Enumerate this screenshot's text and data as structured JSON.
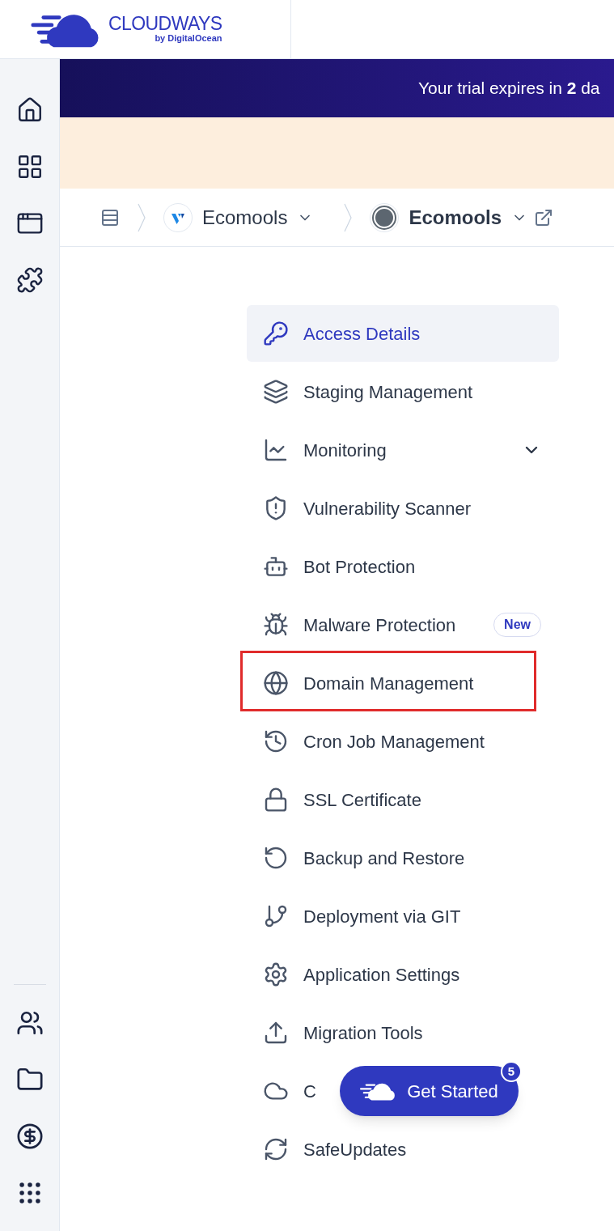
{
  "logo": {
    "name": "CLOUDWAYS",
    "byline": "by DigitalOcean"
  },
  "banner": {
    "text": "Your trial expires in **2** da"
  },
  "breadcrumb": [
    {
      "label": "Ecomools",
      "kind": "server"
    },
    {
      "label": "Ecomools",
      "kind": "app"
    }
  ],
  "menu": [
    {
      "label": "Access Details",
      "selected": true,
      "highlighted": false
    },
    {
      "label": "Staging Management",
      "selected": false,
      "highlighted": false
    },
    {
      "label": "Monitoring",
      "selected": false,
      "highlighted": false,
      "expanded": false
    },
    {
      "label": "Vulnerability Scanner",
      "selected": false,
      "highlighted": false
    },
    {
      "label": "Bot Protection",
      "selected": false,
      "highlighted": false
    },
    {
      "label": "Malware Protection",
      "selected": false,
      "highlighted": false,
      "badge": "New"
    },
    {
      "label": "Domain Management",
      "selected": false,
      "highlighted": true
    },
    {
      "label": "Cron Job Management",
      "selected": false,
      "highlighted": false
    },
    {
      "label": "SSL Certificate",
      "selected": false,
      "highlighted": false
    },
    {
      "label": "Backup and Restore",
      "selected": false,
      "highlighted": false
    },
    {
      "label": "Deployment via GIT",
      "selected": false,
      "highlighted": false
    },
    {
      "label": "Application Settings",
      "selected": false,
      "highlighted": false
    },
    {
      "label": "Migration Tools",
      "selected": false,
      "highlighted": false
    },
    {
      "label": "C",
      "selected": false,
      "highlighted": false
    },
    {
      "label": "SafeUpdates",
      "selected": false,
      "highlighted": false
    }
  ],
  "get_started": {
    "label": "Get Started",
    "count": "5"
  }
}
